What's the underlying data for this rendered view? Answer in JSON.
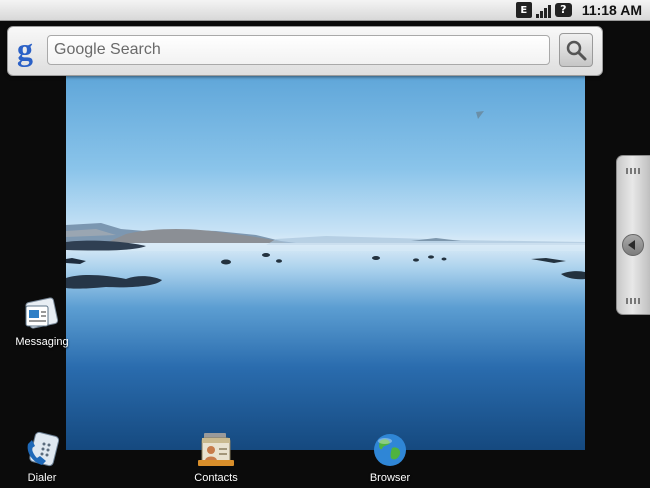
{
  "status_bar": {
    "time": "11:18 AM",
    "icons": [
      "data-e-icon",
      "signal-icon",
      "battery-unknown-icon"
    ],
    "e_label": "E"
  },
  "search_widget": {
    "logo_text": "g",
    "placeholder": "Google Search",
    "search_icon": "magnifier-icon"
  },
  "wallpaper": {
    "description": "lake landscape wallpaper"
  },
  "drawer_handle": {
    "icon": "arrow-left-icon"
  },
  "apps": [
    {
      "label": "Messaging",
      "icon": "messaging-icon"
    },
    {
      "label": "Dialer",
      "icon": "dialer-icon"
    },
    {
      "label": "Contacts",
      "icon": "contacts-icon"
    },
    {
      "label": "Browser",
      "icon": "browser-globe-icon"
    }
  ],
  "colors": {
    "google_blue": "#2b61c7",
    "sky": "#8ac4ea",
    "water": "#2a6cae"
  }
}
